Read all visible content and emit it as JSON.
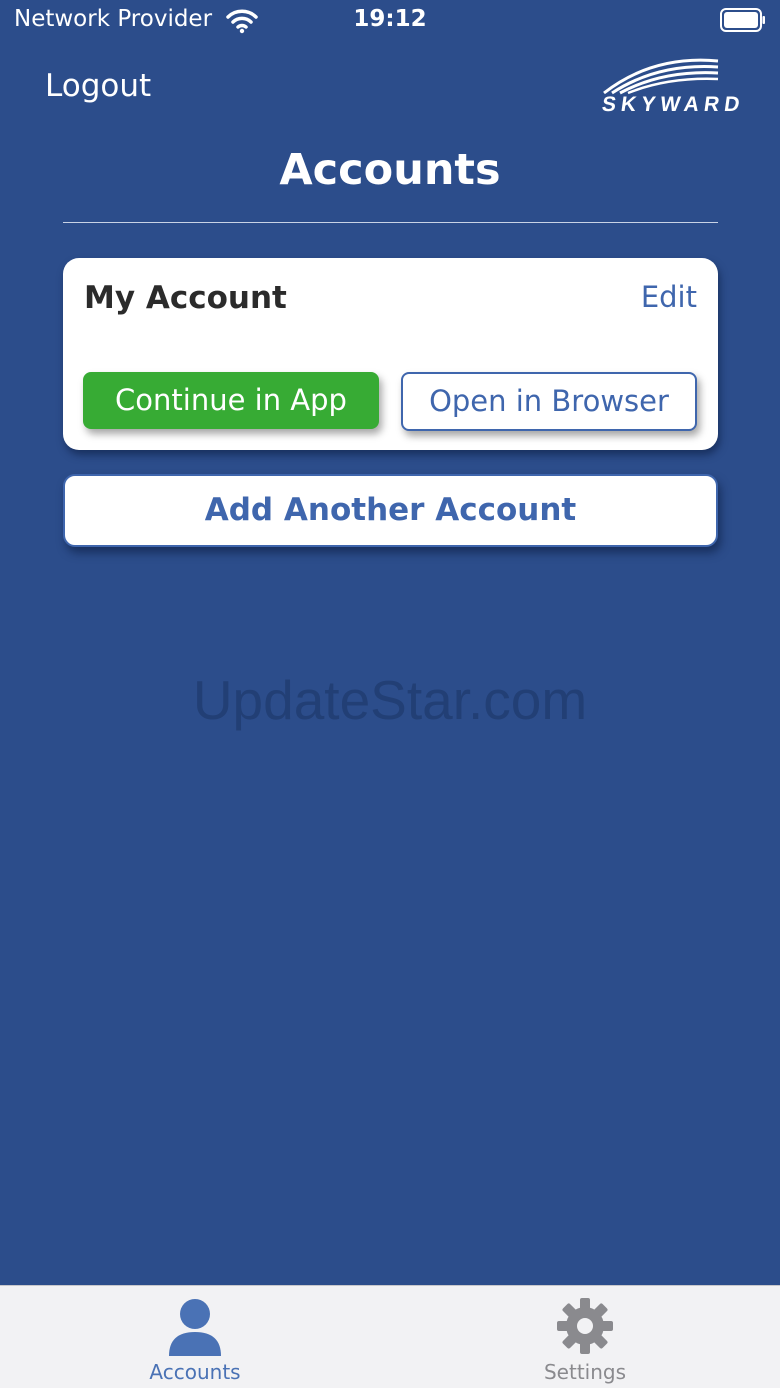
{
  "status_bar": {
    "carrier": "Network Provider",
    "time": "19:12",
    "wifi_icon": "wifi-icon",
    "battery_icon": "battery-icon"
  },
  "header": {
    "logout_label": "Logout",
    "logo_text": "SKYWARD",
    "title": "Accounts"
  },
  "account_card": {
    "name": "My Account",
    "edit_label": "Edit",
    "continue_label": "Continue in App",
    "browser_label": "Open in Browser"
  },
  "add_account_label": "Add Another Account",
  "watermark": "UpdateStar.com",
  "tab_bar": {
    "tabs": [
      {
        "label": "Accounts",
        "icon": "person-icon",
        "selected": true
      },
      {
        "label": "Settings",
        "icon": "gear-icon",
        "selected": false
      }
    ]
  },
  "colors": {
    "background": "#2c4d8b",
    "accent": "#3f66ad",
    "success": "#37ab34",
    "tab_active": "#4a72b5",
    "tab_inactive": "#8a8a8e"
  }
}
